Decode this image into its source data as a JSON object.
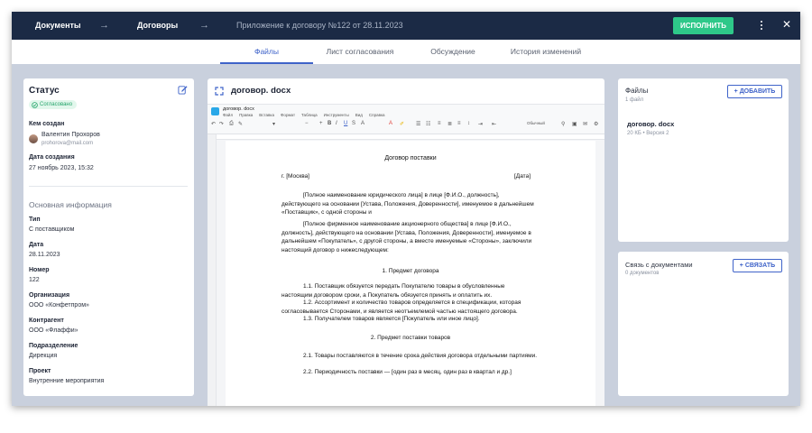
{
  "header": {
    "crumb1": "Документы",
    "crumb2": "Договоры",
    "crumb3": "Приложение к договору №122 от 28.11.2023",
    "execute_label": "ИСПОЛНИТЬ"
  },
  "tabs": [
    {
      "label": "Файлы",
      "active": true
    },
    {
      "label": "Лист согласования",
      "active": false
    },
    {
      "label": "Обсуждение",
      "active": false
    },
    {
      "label": "История изменений",
      "active": false
    }
  ],
  "status": {
    "title": "Статус",
    "badge": "Согласовано",
    "created_by_label": "Кем создан",
    "author_name": "Валентин Прохоров",
    "author_email": "prohorova@mail.com",
    "created_date_label": "Дата создания",
    "created_date": "27 ноябрь 2023, 15:32"
  },
  "info": {
    "title": "Основная информация",
    "fields": [
      {
        "label": "Тип",
        "value": "С поставщиком"
      },
      {
        "label": "Дата",
        "value": "28.11.2023"
      },
      {
        "label": "Номер",
        "value": "122"
      },
      {
        "label": "Организация",
        "value": "ООО «Конфетпром»"
      },
      {
        "label": "Контрагент",
        "value": "ООО «Флаффи»"
      },
      {
        "label": "Подразделение",
        "value": "Дирекция"
      },
      {
        "label": "Проект",
        "value": "Внутренние мероприятия"
      }
    ]
  },
  "viewer": {
    "filename": "договор. docx",
    "editor_filename": "договор. docx",
    "menu": [
      "Файл",
      "Правка",
      "Вставка",
      "Формат",
      "Таблица",
      "Инструменты",
      "Вид",
      "Справка"
    ],
    "font_size": "Обычный",
    "doc": {
      "title": "Договор поставки",
      "city": "г. [Москва]",
      "date": "[Дата]",
      "p1": "[Полное наименование юридического лица] в лице [Ф.И.О., должность], действующего на основании [Устава, Положения, Доверенности], именуемое в дальнейшем «Поставщик», с одной стороны и",
      "p2": "[Полное фирменное наименование акционерного общества] в лице [Ф.И.О., должность], действующего на основании [Устава, Положения, Доверенности], именуемое в дальнейшем «Покупатель», с другой стороны, а вместе именуемые «Стороны», заключили настоящий договор о нижеследующем:",
      "s1": "1. Предмет договора",
      "p11": "1.1. Поставщик обязуется передать Покупателю товары в обусловленные настоящим договором сроки, а Покупатель обязуется принять и оплатить их.",
      "p12": "1.2. Ассортимент и количество товаров определяется в спецификации, которая согласовывается Сторонами, и является неотъемлемой частью настоящего договора.",
      "p13": "1.3. Получателем товаров является [Покупатель или иное лицо].",
      "s2": "2. Предмет поставки товаров",
      "p21": "2.1. Товары поставляются в течение срока действия договора отдельными партиями.",
      "p22": "2.2. Периодичность поставки — [один раз в месяц, один раз в квартал и др.]"
    }
  },
  "files": {
    "title": "Файлы",
    "count": "1 файл",
    "add_label": "ДОБАВИТЬ",
    "item_name": "договор. docx",
    "item_meta": "20 КБ • Версия 2"
  },
  "links": {
    "title": "Связь с документами",
    "count": "0 документов",
    "link_label": "СВЯЗАТЬ"
  },
  "colors": {
    "header_bg": "#1b2a45",
    "accent": "#3f63c9",
    "execute": "#2ec889",
    "status_green": "#25a56b"
  }
}
